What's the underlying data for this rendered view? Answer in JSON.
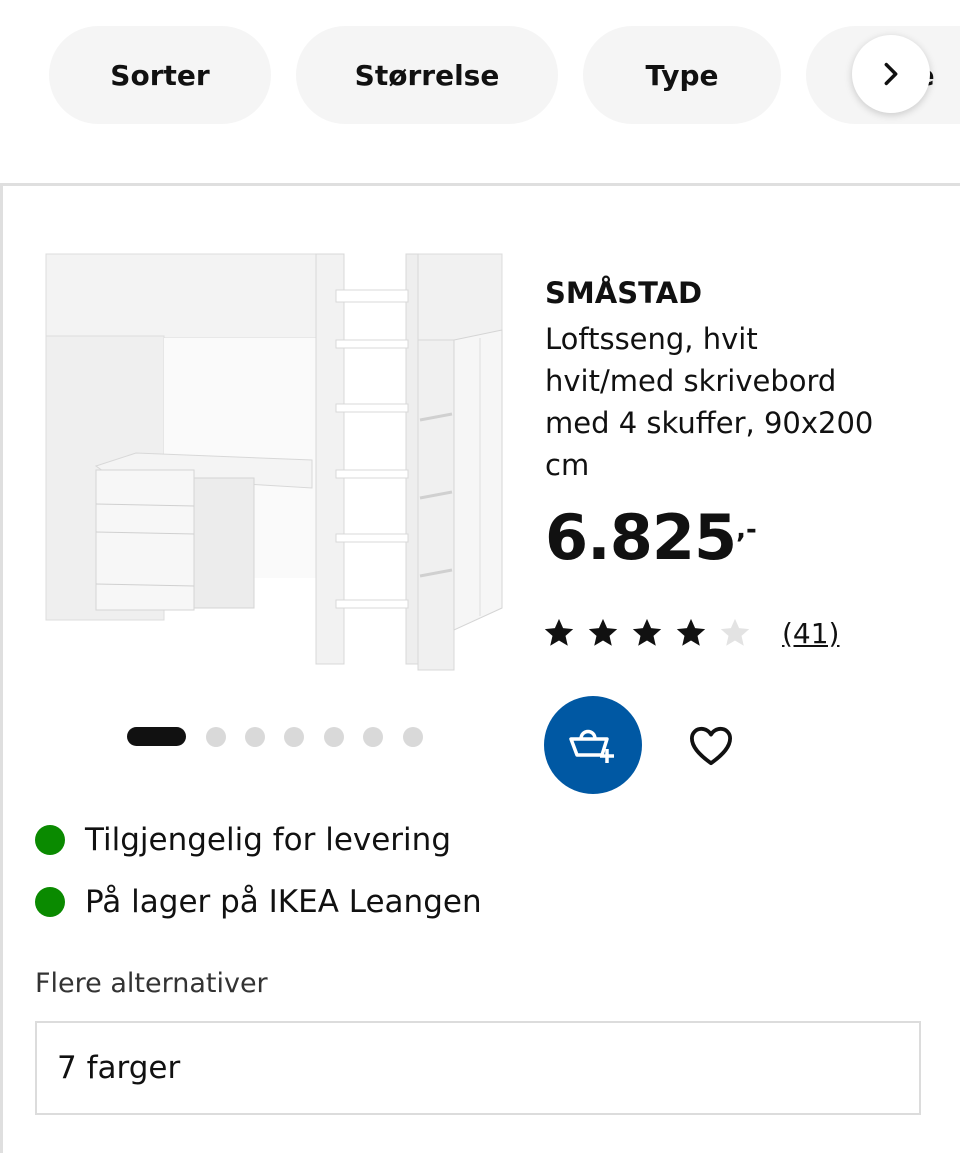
{
  "filters": {
    "chips": [
      {
        "label": "Sorter"
      },
      {
        "label": "Størrelse"
      },
      {
        "label": "Type"
      },
      {
        "label": "je"
      }
    ],
    "scroll_icon": "chevron-right-icon"
  },
  "product": {
    "brand": "SMÅSTAD",
    "description_lines": [
      "Loftsseng, hvit",
      "hvit/med skrivebord",
      "med 4 skuffer, 90x200",
      "cm"
    ],
    "price": "6.825",
    "price_suffix": ",-",
    "rating": {
      "stars": 4,
      "max": 5,
      "review_count": "(41)"
    },
    "image_icon": "loft-bed-with-desk-image",
    "carousel": {
      "total": 7,
      "active": 0
    },
    "colors": {
      "accent": "#0058a3",
      "available": "#0a8a00"
    }
  },
  "actions": {
    "cart_icon": "add-to-cart-icon",
    "favorite_icon": "heart-icon"
  },
  "availability": [
    {
      "text": "Tilgjengelig for levering"
    },
    {
      "text": "På lager på IKEA Leangen"
    }
  ],
  "alternatives": {
    "label": "Flere alternativer",
    "value": "7 farger"
  }
}
